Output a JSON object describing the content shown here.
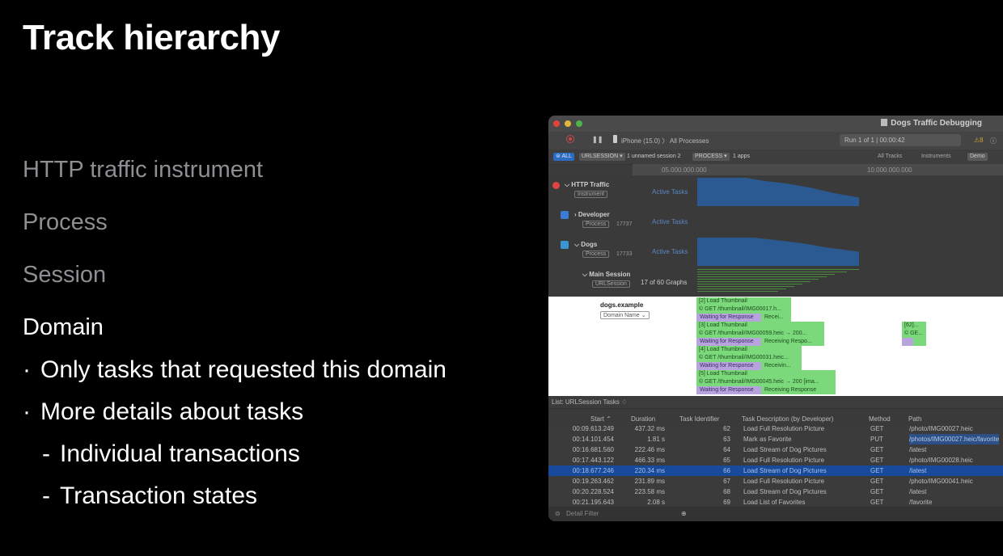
{
  "slide": {
    "title": "Track hierarchy",
    "bullets": [
      {
        "text": "HTTP traffic instrument"
      },
      {
        "text": "Process"
      },
      {
        "text": "Session"
      },
      {
        "text": "Domain"
      }
    ],
    "sub_bullets": [
      "Only tasks that requested this domain",
      "More details about tasks"
    ],
    "subsub_bullets": [
      "Individual transactions",
      "Transaction states"
    ],
    "bullet_glyph": "·",
    "dash_glyph": "-"
  },
  "window": {
    "title": "Dogs Traffic Debugging",
    "device": "iPhone (15.0)",
    "breadcrumb_sep": "〉",
    "target": "All Processes",
    "run_info": "Run 1 of 1  |  00:00:42",
    "warnings": "8",
    "filter": {
      "all": "ALL",
      "urlsession_chip": "URLSESSION",
      "urlsession_value": "1 unnamed session 2",
      "process_chip": "PROCESS",
      "process_value": "1 apps",
      "all_tracks": "All Tracks",
      "instruments": "Instruments",
      "demo": "Demo"
    },
    "ruler": {
      "mark1": "05.000.000.000",
      "mark2": "10.000.000.000"
    },
    "tracks": [
      {
        "name": "HTTP Traffic",
        "tag": "Instrument",
        "pid": "",
        "graph": "Active Tasks"
      },
      {
        "name": "Developer",
        "tag": "Process",
        "pid": "17737",
        "graph": "Active Tasks"
      },
      {
        "name": "Dogs",
        "tag": "Process",
        "pid": "17733",
        "graph": "Active Tasks"
      },
      {
        "name": "Main Session",
        "tag": "URLSession",
        "pid": "",
        "graph": "17 of 60 Graphs"
      }
    ],
    "domain": {
      "name": "dogs.example",
      "tag": "Domain Name",
      "tasks": [
        {
          "title": "[2] Load Thumbnail",
          "req": "© GET /thumbnail/IMG00017.h...",
          "wait": "Waiting for Response",
          "recv": "Recei..."
        },
        {
          "title": "[3] Load Thumbnail",
          "req": "© GET /thumbnail/IMG00059.heic → 200...",
          "wait": "Waiting for Response",
          "recv": "Receiving Respo..."
        },
        {
          "title": "[4] Load Thumbnail",
          "req": "© GET /thumbnail/IMG00031.heic...",
          "wait": "Waiting for Response",
          "recv": "Receivin..."
        },
        {
          "title": "[5] Load Thumbnail",
          "req": "© GET /thumbnail/IMG00045.heic → 200 [ima...",
          "wait": "Waiting for Response",
          "recv": "Receiving Response"
        },
        {
          "title": "[62]...",
          "req": "© GE...",
          "wait": "",
          "recv": ""
        }
      ]
    },
    "list": {
      "title": "List: URLSession Tasks ♢",
      "columns": [
        "Start",
        "Duration",
        "Task Identifier",
        "Task Description (by Developer)",
        "Method",
        "Path"
      ],
      "rows": [
        [
          "00:09.613.249",
          "437.32 ms",
          "62",
          "Load Full Resolution Picture",
          "GET",
          "/photo/IMG00027.heic"
        ],
        [
          "00:14.101.454",
          "1.81 s",
          "63",
          "Mark as Favorite",
          "PUT",
          "/photos/IMG00027.heic/favorite"
        ],
        [
          "00:16.681.560",
          "222.46 ms",
          "64",
          "Load Stream of Dog Pictures",
          "GET",
          "/latest"
        ],
        [
          "00:17.443.122",
          "466.33 ms",
          "65",
          "Load Full Resolution Picture",
          "GET",
          "/photo/IMG00028.heic"
        ],
        [
          "00:18.677.246",
          "220.34 ms",
          "66",
          "Load Stream of Dog Pictures",
          "GET",
          "/latest"
        ],
        [
          "00:19.263.462",
          "231.89 ms",
          "67",
          "Load Full Resolution Picture",
          "GET",
          "/photo/IMG00041.heic"
        ],
        [
          "00:20.228.524",
          "223.58 ms",
          "68",
          "Load Stream of Dog Pictures",
          "GET",
          "/latest"
        ],
        [
          "00:21.195.643",
          "2.08 s",
          "69",
          "Load List of Favorites",
          "GET",
          "/favorite"
        ]
      ],
      "selected_row": 4
    },
    "detail_filter": "Detail Filter"
  },
  "colors": {
    "accent_blue": "#2b5a93",
    "task_green": "#7bd87b",
    "waiting_purple": "#b8a4dd",
    "selection": "#174a9a"
  }
}
